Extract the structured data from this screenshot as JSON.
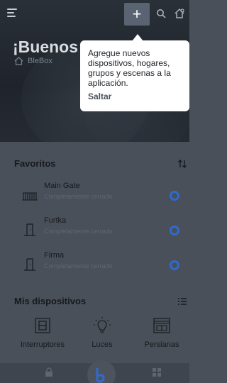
{
  "topbar": {
    "menu_icon": "hamburger-icon",
    "add_label": "+",
    "search_icon": "search-icon",
    "home_settings_icon": "home-icon"
  },
  "hero": {
    "greeting": "¡Buenos d",
    "location": "BleBox",
    "location_icon": "home-outline-icon"
  },
  "tooltip": {
    "text": "Agregue nuevos dispositivos, hogares, grupos y escenas a la aplicación.",
    "skip_label": "Saltar"
  },
  "favorites": {
    "title": "Favoritos",
    "sort_icon": "sort-icon",
    "items": [
      {
        "name": "Main Gate",
        "status": "Completamente cerrado",
        "icon": "gate-icon"
      },
      {
        "name": "Furtka",
        "status": "Completamente cerrado",
        "icon": "door-icon"
      },
      {
        "name": "Firma",
        "status": "Completamente cerrado",
        "icon": "door-icon"
      }
    ],
    "status_color": "#2f6ad0"
  },
  "my_devices": {
    "title": "Mis dispositivos",
    "list_icon": "list-icon",
    "categories": [
      {
        "label": "Interruptores",
        "icon": "switch-icon"
      },
      {
        "label": "Luces",
        "icon": "bulb-icon"
      },
      {
        "label": "Persianas",
        "icon": "blinds-icon"
      }
    ]
  },
  "bottom_nav": {
    "items": [
      "lock-icon",
      "blebox-logo-icon",
      "grid-icon"
    ]
  }
}
